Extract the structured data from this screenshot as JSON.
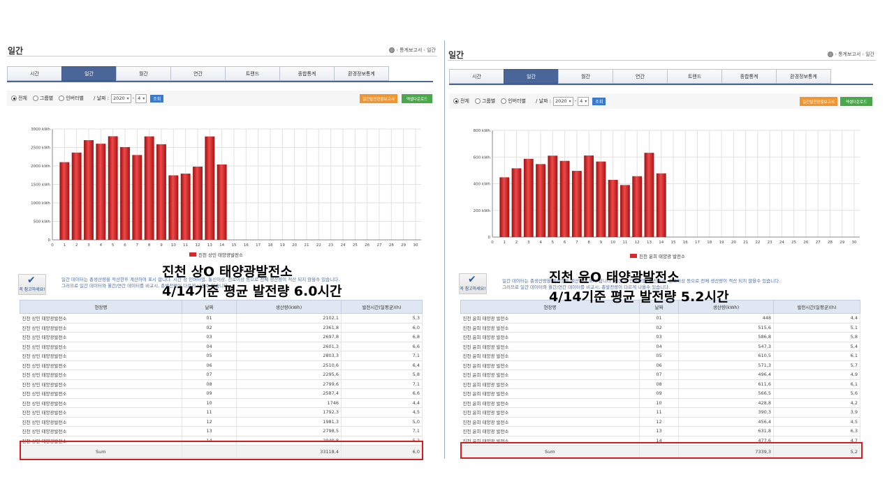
{
  "left": {
    "title": "일간",
    "breadcrumb": [
      "통계보고서",
      "일간"
    ],
    "tabs": [
      "시간",
      "일간",
      "월간",
      "연간",
      "트랜드",
      "종합통계",
      "환경정보통계"
    ],
    "active_tab": 1,
    "filters": {
      "radios": [
        "전체",
        "그룹별",
        "인버터별"
      ],
      "selected_radio": 0,
      "date_label": "/ 날짜 :",
      "year": "2020",
      "month": "4",
      "go": "조회",
      "btn_report": "일간발전현황보고서",
      "btn_excel": "엑셀다운로드"
    },
    "chart_data": {
      "type": "bar",
      "categories": [
        "0",
        "1",
        "2",
        "3",
        "4",
        "5",
        "6",
        "7",
        "8",
        "9",
        "10",
        "11",
        "12",
        "13",
        "14",
        "15",
        "16",
        "17",
        "18",
        "19",
        "20",
        "21",
        "22",
        "23",
        "24",
        "25",
        "26",
        "27",
        "28",
        "29",
        "30"
      ],
      "series": [
        {
          "name": "진천 상민 태양광발전소",
          "values": [
            null,
            2102.1,
            2361.8,
            2697.8,
            2601.3,
            2803.3,
            2510.6,
            2295.6,
            2799.6,
            2587.4,
            1746,
            1792.3,
            1981.3,
            2798.5,
            2040.8,
            null,
            null,
            null,
            null,
            null,
            null,
            null,
            null,
            null,
            null,
            null,
            null,
            null,
            null,
            null,
            null
          ]
        }
      ],
      "y_ticks": [
        "0",
        "500 kWh",
        "1000 kWh",
        "1500 kWh",
        "2000 kWh",
        "2500 kWh",
        "3000 kWh"
      ],
      "ylim": [
        0,
        3000
      ],
      "grid": true,
      "legend": "bottom-center",
      "bar_color": "#d42a2a"
    },
    "note": {
      "badge": "꼭 참고하세요!",
      "line1": "일간 데이터는 총생산량을 적산한후 계산하여 표시 합니다. 시간 상 인버터별, 통신이상, 선로이상 등으로 전체 생산량이 적산 되지 않을수 있습니다.",
      "line2": "그러므로 일간 데이터와 월간/연간 데이터를 비교시, 총발전량이 다르게 나올수 있습니다."
    },
    "overlay_line1": "진천 상O 태양광발전소",
    "overlay_line2": "4/14기준 평균 발전량 6.0시간",
    "table": {
      "headers": [
        "현장명",
        "날짜",
        "생산량(kWh)",
        "발전시간(일평균)(h)"
      ],
      "rows": [
        [
          "진천 상민 태양광발전소",
          "01",
          "2102,1",
          "5,3"
        ],
        [
          "진천 상민 태양광발전소",
          "02",
          "2361,8",
          "6,0"
        ],
        [
          "진천 상민 태양광발전소",
          "03",
          "2697,8",
          "6,8"
        ],
        [
          "진천 상민 태양광발전소",
          "04",
          "2601,3",
          "6,6"
        ],
        [
          "진천 상민 태양광발전소",
          "05",
          "2803,3",
          "7,1"
        ],
        [
          "진천 상민 태양광발전소",
          "06",
          "2510,6",
          "6,4"
        ],
        [
          "진천 상민 태양광발전소",
          "07",
          "2295,6",
          "5,8"
        ],
        [
          "진천 상민 태양광발전소",
          "08",
          "2799,6",
          "7,1"
        ],
        [
          "진천 상민 태양광발전소",
          "09",
          "2587,4",
          "6,6"
        ],
        [
          "진천 상민 태양광발전소",
          "10",
          "1746",
          "4,4"
        ],
        [
          "진천 상민 태양광발전소",
          "11",
          "1792,3",
          "4,5"
        ],
        [
          "진천 상민 태양광발전소",
          "12",
          "1981,3",
          "5,0"
        ],
        [
          "진천 상민 태양광발전소",
          "13",
          "2798,5",
          "7,1"
        ],
        [
          "진천 상민 태양광발전소",
          "14",
          "2040,8",
          "5,2"
        ]
      ],
      "sum": [
        "Sum",
        "",
        "33118,4",
        "6,0"
      ]
    }
  },
  "right": {
    "title": "일간",
    "breadcrumb": [
      "통계보고서",
      "일간"
    ],
    "tabs": [
      "시간",
      "일간",
      "월간",
      "연간",
      "트랜드",
      "종합통계",
      "환경정보통계"
    ],
    "active_tab": 1,
    "filters": {
      "radios": [
        "전체",
        "그룹별",
        "인버터별"
      ],
      "selected_radio": 0,
      "date_label": "/ 날짜 :",
      "year": "2020",
      "month": "4",
      "go": "조회",
      "btn_report": "일간발전현황보고서",
      "btn_excel": "엑셀다운로드"
    },
    "chart_data": {
      "type": "bar",
      "categories": [
        "0",
        "1",
        "2",
        "3",
        "4",
        "5",
        "6",
        "7",
        "8",
        "9",
        "10",
        "11",
        "12",
        "13",
        "14",
        "15",
        "16",
        "17",
        "18",
        "19",
        "20",
        "21",
        "22",
        "23",
        "24",
        "25",
        "26",
        "27",
        "28",
        "29",
        "30"
      ],
      "series": [
        {
          "name": "진천 윤희 태양광 발전소",
          "values": [
            null,
            448,
            515.6,
            586.8,
            547.3,
            610.5,
            571.3,
            496.4,
            611.6,
            566.5,
            428.8,
            390.3,
            456.4,
            631.8,
            477.6,
            null,
            null,
            null,
            null,
            null,
            null,
            null,
            null,
            null,
            null,
            null,
            null,
            null,
            null,
            null,
            null
          ]
        }
      ],
      "y_ticks": [
        "0",
        "200 kWh",
        "400 kWh",
        "600 kWh",
        "800 kWh"
      ],
      "ylim": [
        0,
        800
      ],
      "grid": true,
      "legend": "bottom-center",
      "bar_color": "#d42a2a"
    },
    "note": {
      "badge": "꼭 참고하세요!",
      "line1": "일간 데이터는 총생산량을 적산한후 계산하여 표시 합니다. 시간 상 인버터별, 통신이상, 선로이상 등으로 전체 생산량이 적산 되지 않을수 있습니다.",
      "line2": "그러므로 일간 데이터와 월간/연간 데이터를 비교시, 총발전량이 다르게 나올수 있습니다."
    },
    "overlay_line1": "진천 윤O 태양광발전소",
    "overlay_line2": "4/14기준 평균 발전량 5.2시간",
    "table": {
      "headers": [
        "현장명",
        "날짜",
        "생산량(kWh)",
        "발전시간(일평균)(h)"
      ],
      "rows": [
        [
          "진천 윤희 태양광 발전소",
          "01",
          "448",
          "4,4"
        ],
        [
          "진천 윤희 태양광 발전소",
          "02",
          "515,6",
          "5,1"
        ],
        [
          "진천 윤희 태양광 발전소",
          "03",
          "586,8",
          "5,8"
        ],
        [
          "진천 윤희 태양광 발전소",
          "04",
          "547,3",
          "5,4"
        ],
        [
          "진천 윤희 태양광 발전소",
          "05",
          "610,5",
          "6,1"
        ],
        [
          "진천 윤희 태양광 발전소",
          "06",
          "571,3",
          "5,7"
        ],
        [
          "진천 윤희 태양광 발전소",
          "07",
          "496,4",
          "4,9"
        ],
        [
          "진천 윤희 태양광 발전소",
          "08",
          "611,6",
          "6,1"
        ],
        [
          "진천 윤희 태양광 발전소",
          "09",
          "566,5",
          "5,6"
        ],
        [
          "진천 윤희 태양광 발전소",
          "10",
          "428,8",
          "4,2"
        ],
        [
          "진천 윤희 태양광 발전소",
          "11",
          "390,3",
          "3,9"
        ],
        [
          "진천 윤희 태양광 발전소",
          "12",
          "456,4",
          "4,5"
        ],
        [
          "진천 윤희 태양광 발전소",
          "13",
          "631,8",
          "6,3"
        ],
        [
          "진천 윤희 태양광 발전소",
          "14",
          "477,6",
          "4,7"
        ]
      ],
      "sum": [
        "Sum",
        "",
        "7339,3",
        "5,2"
      ]
    }
  }
}
